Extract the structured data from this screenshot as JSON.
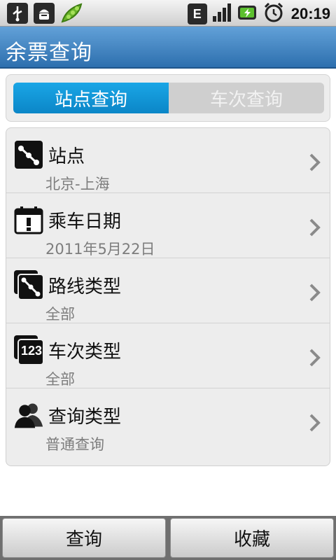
{
  "status_bar": {
    "clock": "20:19",
    "network_letter": "E",
    "left_icons": [
      "usb-icon",
      "android-debug-icon",
      "pea-pod-icon"
    ],
    "right_icons": [
      "edge-network-icon",
      "signal-icon",
      "battery-icon",
      "alarm-icon"
    ]
  },
  "header": {
    "title": "余票查询"
  },
  "tabs": [
    {
      "label": "站点查询",
      "active": true
    },
    {
      "label": "车次查询",
      "active": false
    }
  ],
  "list": {
    "items": [
      {
        "icon": "station-route-icon",
        "title": "站点",
        "subtitle": "北京-上海"
      },
      {
        "icon": "calendar-icon",
        "title": "乘车日期",
        "subtitle": "2011年5月22日"
      },
      {
        "icon": "route-type-icon",
        "title": "路线类型",
        "subtitle": "全部"
      },
      {
        "icon": "train-number-icon",
        "icon_text": "123",
        "title": "车次类型",
        "subtitle": "全部"
      },
      {
        "icon": "users-icon",
        "title": "查询类型",
        "subtitle": "普通查询"
      }
    ]
  },
  "footer": {
    "query_label": "查询",
    "favorite_label": "收藏"
  },
  "colors": {
    "accent": "#0b86c7",
    "title_bar": "#2d6fae",
    "subtitle_text": "#7d7d7d"
  }
}
